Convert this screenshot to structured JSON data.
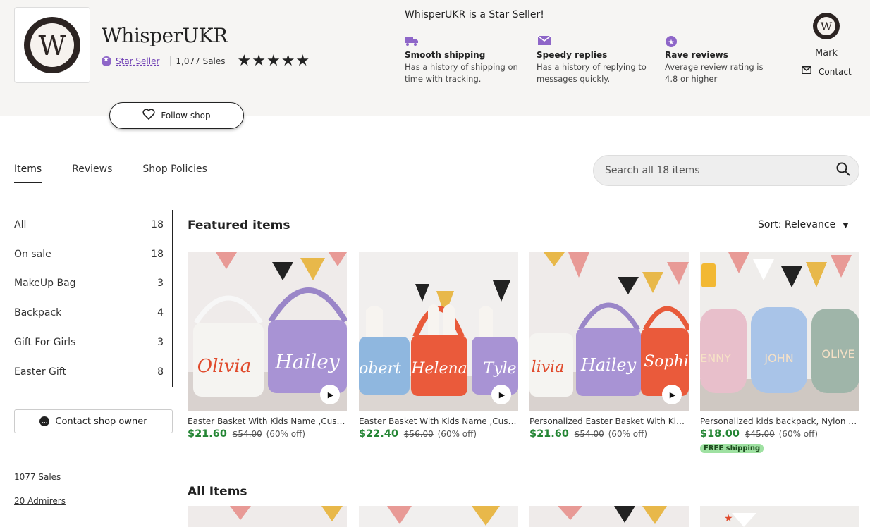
{
  "shop": {
    "name": "WhisperUKR",
    "logo_letter": "W",
    "star_seller_label": "Star Seller",
    "sales": "1,077 Sales",
    "rating_stars": 5,
    "stars_glyph": "★★★★★"
  },
  "star_seller": {
    "title": "WhisperUKR is a Star Seller!",
    "features": [
      {
        "icon": "truck-icon",
        "glyph": "🚚",
        "title": "Smooth shipping",
        "desc": "Has a history of shipping on time with tracking."
      },
      {
        "icon": "envelope-icon",
        "glyph": "✉",
        "title": "Speedy replies",
        "desc": "Has a history of replying to messages quickly."
      },
      {
        "icon": "star-badge-icon",
        "glyph": "✪",
        "title": "Rave reviews",
        "desc": "Average review rating is 4.8 or higher"
      }
    ]
  },
  "owner": {
    "name": "Mark",
    "contact_label": "Contact"
  },
  "follow_label": "Follow shop",
  "tabs": [
    {
      "label": "Items",
      "active": true
    },
    {
      "label": "Reviews",
      "active": false
    },
    {
      "label": "Shop Policies",
      "active": false
    }
  ],
  "search": {
    "placeholder": "Search all 18 items"
  },
  "categories": [
    {
      "label": "All",
      "count": "18"
    },
    {
      "label": "On sale",
      "count": "18"
    },
    {
      "label": "MakeUp Bag",
      "count": "3"
    },
    {
      "label": "Backpack",
      "count": "4"
    },
    {
      "label": "Gift For Girls",
      "count": "3"
    },
    {
      "label": "Easter Gift",
      "count": "8"
    }
  ],
  "contact_owner_label": "Contact shop owner",
  "stats": {
    "sales": "1077 Sales",
    "admirers": "20 Admirers"
  },
  "featured_title": "Featured items",
  "all_items_title": "All Items",
  "sort_label": "Sort: Relevance",
  "products": [
    {
      "title": "Easter Basket With Kids Name ,Custom...",
      "price": "$21.60",
      "old_price": "$54.00",
      "discount": "(60% off)",
      "video": true,
      "free_shipping": ""
    },
    {
      "title": "Easter Basket With Kids Name ,Custom...",
      "price": "$22.40",
      "old_price": "$56.00",
      "discount": "(60% off)",
      "video": true,
      "free_shipping": ""
    },
    {
      "title": "Personalized Easter Basket With Kids Name...",
      "price": "$21.60",
      "old_price": "$54.00",
      "discount": "(60% off)",
      "video": true,
      "free_shipping": ""
    },
    {
      "title": "Personalized kids backpack, Nylon School...",
      "price": "$18.00",
      "old_price": "$45.00",
      "discount": "(60% off)",
      "video": false,
      "free_shipping": "FREE shipping"
    }
  ],
  "colors": {
    "accent_purple": "#6f3fb5",
    "sale_green": "#258635",
    "free_ship_bg": "#9fe1a2"
  }
}
